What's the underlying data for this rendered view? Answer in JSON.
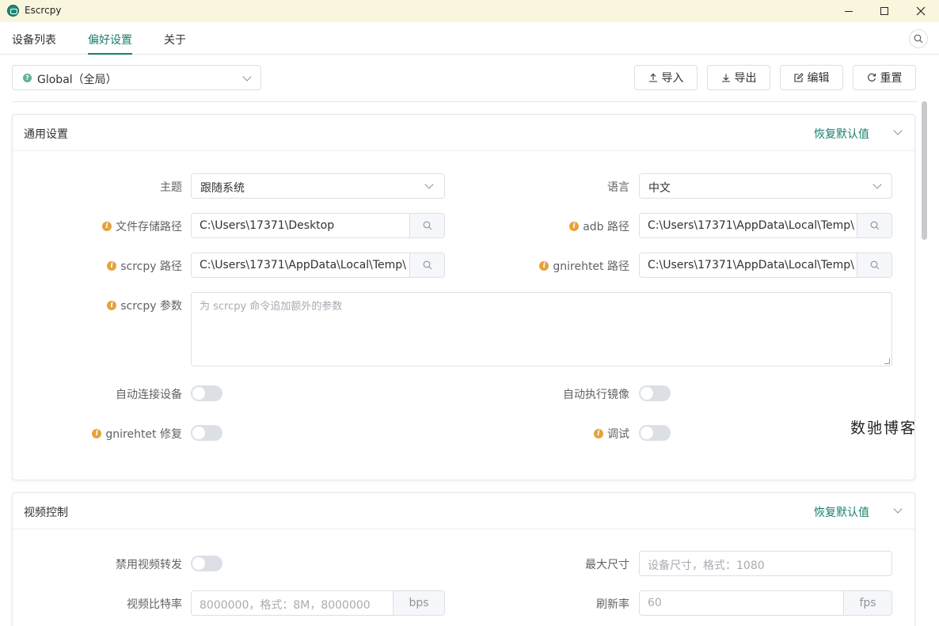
{
  "window": {
    "title": "Escrcpy"
  },
  "tabs": [
    {
      "label": "设备列表"
    },
    {
      "label": "偏好设置"
    },
    {
      "label": "关于"
    }
  ],
  "toolbar": {
    "scope": "Global（全局）",
    "import_label": "导入",
    "export_label": "导出",
    "edit_label": "编辑",
    "reset_label": "重置"
  },
  "general": {
    "title": "通用设置",
    "reset_default": "恢复默认值",
    "theme_label": "主题",
    "theme_value": "跟随系统",
    "language_label": "语言",
    "language_value": "中文",
    "save_path_label": "文件存储路径",
    "save_path_value": "C:\\Users\\17371\\Desktop",
    "adb_path_label": "adb 路径",
    "adb_path_value": "C:\\Users\\17371\\AppData\\Local\\Temp\\",
    "scrcpy_path_label": "scrcpy 路径",
    "scrcpy_path_value": "C:\\Users\\17371\\AppData\\Local\\Temp\\",
    "gnirehtet_path_label": "gnirehtet 路径",
    "gnirehtet_path_value": "C:\\Users\\17371\\AppData\\Local\\Temp\\",
    "scrcpy_args_label": "scrcpy 参数",
    "scrcpy_args_placeholder": "为 scrcpy 命令追加额外的参数",
    "auto_connect_label": "自动连接设备",
    "auto_mirror_label": "自动执行镜像",
    "gnirehtet_fix_label": "gnirehtet 修复",
    "debug_label": "调试"
  },
  "video": {
    "title": "视频控制",
    "reset_default": "恢复默认值",
    "disable_video_label": "禁用视频转发",
    "max_size_label": "最大尺寸",
    "max_size_placeholder": "设备尺寸，格式：1080",
    "bitrate_label": "视频比特率",
    "bitrate_placeholder": "8000000，格式：8M，8000000",
    "bitrate_unit": "bps",
    "fps_label": "刷新率",
    "fps_placeholder": "60",
    "fps_unit": "fps"
  },
  "watermark": "数驰博客",
  "colors": {
    "accent": "#1a7f6e",
    "warning": "#e6a23c",
    "titlebar": "#faf6dd"
  }
}
